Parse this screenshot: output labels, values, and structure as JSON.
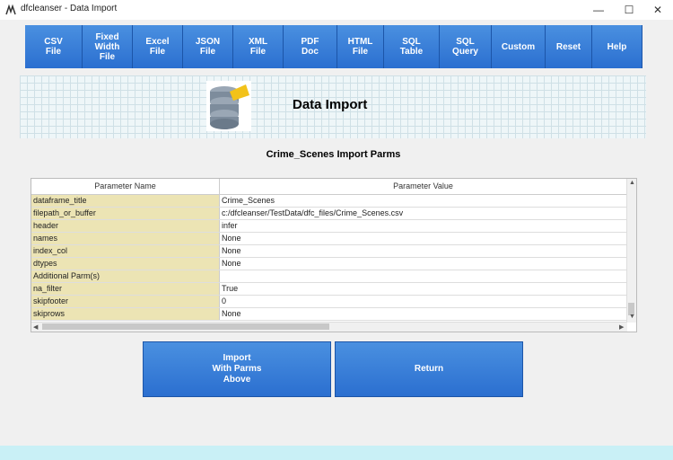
{
  "window": {
    "title": "dfcleanser - Data Import",
    "minimize": "—",
    "maximize": "☐",
    "close": "✕"
  },
  "toolbar": [
    {
      "label": "CSV\nFile"
    },
    {
      "label": "Fixed\nWidth\nFile"
    },
    {
      "label": "Excel\nFile"
    },
    {
      "label": "JSON\nFile"
    },
    {
      "label": "XML\nFile"
    },
    {
      "label": "PDF\nDoc"
    },
    {
      "label": "HTML\nFile"
    },
    {
      "label": "SQL\nTable"
    },
    {
      "label": "SQL\nQuery"
    },
    {
      "label": "Custom"
    },
    {
      "label": "Reset"
    },
    {
      "label": "Help"
    }
  ],
  "banner": {
    "title": "Data Import",
    "icon": "database-icon"
  },
  "section_title": "Crime_Scenes Import Parms",
  "grid": {
    "headers": [
      "Parameter Name",
      "Parameter Value"
    ],
    "rows": [
      {
        "name": "dataframe_title",
        "value": "Crime_Scenes"
      },
      {
        "name": "filepath_or_buffer",
        "value": "c:/dfcleanser/TestData/dfc_files/Crime_Scenes.csv"
      },
      {
        "name": "header",
        "value": "infer"
      },
      {
        "name": "names",
        "value": "None"
      },
      {
        "name": "index_col",
        "value": "None"
      },
      {
        "name": "dtypes",
        "value": "None"
      },
      {
        "name": "Additional Parm(s)",
        "value": ""
      },
      {
        "name": "na_filter",
        "value": "True"
      },
      {
        "name": "skipfooter",
        "value": "0"
      },
      {
        "name": "skiprows",
        "value": "None"
      }
    ]
  },
  "buttons": {
    "import": "Import\nWith Parms\nAbove",
    "return": "Return"
  },
  "colors": {
    "button": "#3a7fd8",
    "name_cell": "#ece4b4",
    "footer": "#c9f0f6"
  }
}
